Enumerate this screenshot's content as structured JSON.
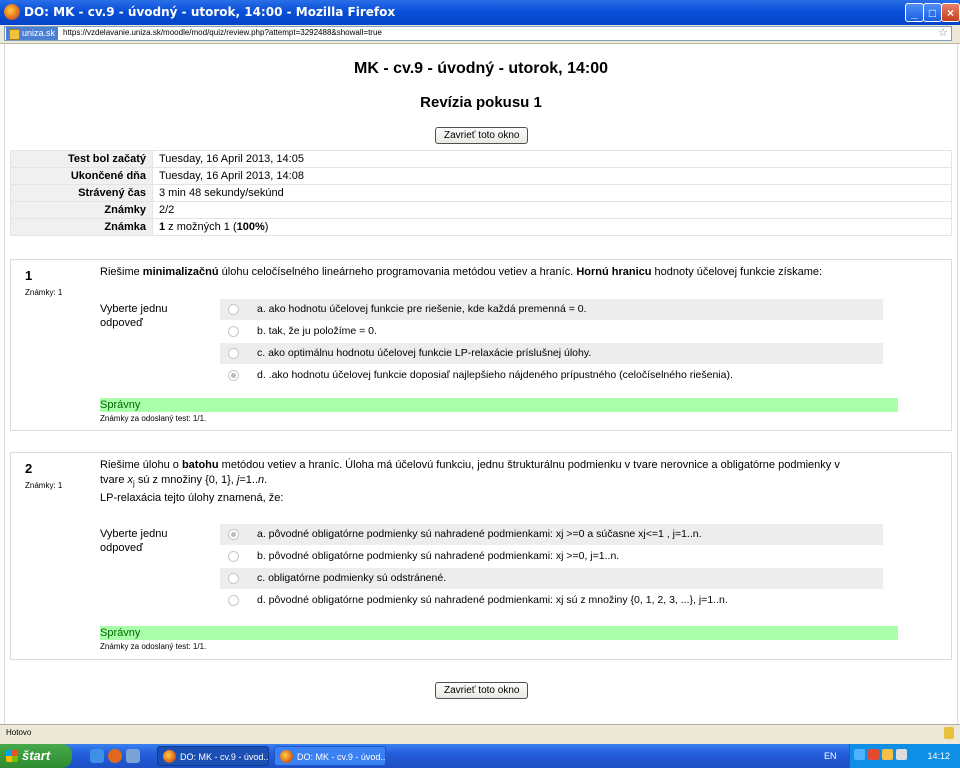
{
  "window": {
    "title": "DO: MK - cv.9 - úvodný - utorok, 14:00 - Mozilla Firefox"
  },
  "address": {
    "site": "uniza.sk",
    "url": "https://vzdelavanie.uniza.sk/moodle/mod/quiz/review.php?attempt=3292488&showall=true"
  },
  "page": {
    "title": "MK - cv.9 - úvodný - utorok, 14:00",
    "subtitle": "Revízia pokusu 1",
    "close_button": "Zavrieť toto okno"
  },
  "summary": [
    {
      "label": "Test bol začatý",
      "value": "Tuesday, 16 April 2013, 14:05"
    },
    {
      "label": "Ukončené dňa",
      "value": "Tuesday, 16 April 2013, 14:08"
    },
    {
      "label": "Strávený čas",
      "value": "3 min 48 sekundy/sekúnd"
    },
    {
      "label": "Známky",
      "value": "2/2"
    },
    {
      "label": "Známka",
      "value_bold": "1",
      "value_mid": " z možných 1 (",
      "value_pct": "100%",
      "value_end": ")"
    }
  ],
  "questions": [
    {
      "number": "1",
      "marks": "Známky: 1",
      "text_parts": [
        "Riešime ",
        "minimalizačnú",
        " úlohu celočíselného lineárneho programovania metódou vetiev a hraníc. ",
        "Hornú hranicu",
        " hodnoty účelovej funkcie získame:"
      ],
      "prompt": "Vyberte jednu odpoveď",
      "answers": [
        {
          "label": "a. ako hodnotu účelovej funkcie pre riešenie, kde každá premenná = 0.",
          "selected": false
        },
        {
          "label": "b. tak, že ju položíme = 0.",
          "selected": false
        },
        {
          "label": "c. ako optimálnu hodnotu účelovej funkcie LP-relaxácie príslušnej úlohy.",
          "selected": false
        },
        {
          "label": "d. .ako hodnotu účelovej funkcie doposiaľ najlepšieho nájdeného prípustného (celočíselného riešenia).",
          "selected": true
        }
      ],
      "result": "Správny",
      "footer": "Známky za odoslaný test: 1/1."
    },
    {
      "number": "2",
      "marks": "Známky: 1",
      "text_line1_parts": [
        "Riešime úlohu o ",
        "batohu",
        " metódou vetiev a hraníc. Úloha má účelovú funkciu, jednu štrukturálnu podmienku v tvare nerovnice a obligatórne podmienky v"
      ],
      "text_line2_parts": [
        "tvare ",
        "x",
        "j",
        " sú z množiny {0, 1}, ",
        "j",
        "=1..",
        "n",
        "."
      ],
      "text_line3": "LP-relaxácia tejto úlohy znamená, že:",
      "prompt": "Vyberte jednu odpoveď",
      "answers": [
        {
          "label": "a. pôvodné obligatórne podmienky sú nahradené podmienkami: xj >=0 a súčasne xj<=1 , j=1..n.",
          "selected": true
        },
        {
          "label": "b. pôvodné obligatórne podmienky sú nahradené podmienkami: xj >=0, j=1..n.",
          "selected": false
        },
        {
          "label": "c. obligatórne podmienky sú odstránené.",
          "selected": false
        },
        {
          "label": "d. pôvodné obligatórne podmienky sú nahradené podmienkami: xj sú z množiny {0, 1, 2, 3, ...}, j=1..n.",
          "selected": false
        }
      ],
      "result": "Správny",
      "footer": "Známky za odoslaný test: 1/1."
    }
  ],
  "status": {
    "text": "Hotovo"
  },
  "taskbar": {
    "start": "štart",
    "tasks": [
      "DO: MK - cv.9 - úvod...",
      "DO: MK - cv.9 - úvod..."
    ],
    "lang": "EN",
    "clock": "14:12"
  },
  "colors": {
    "correct_bg": "#aaffaa",
    "titlebar": "#0a4fd8",
    "taskbar": "#245edb"
  }
}
